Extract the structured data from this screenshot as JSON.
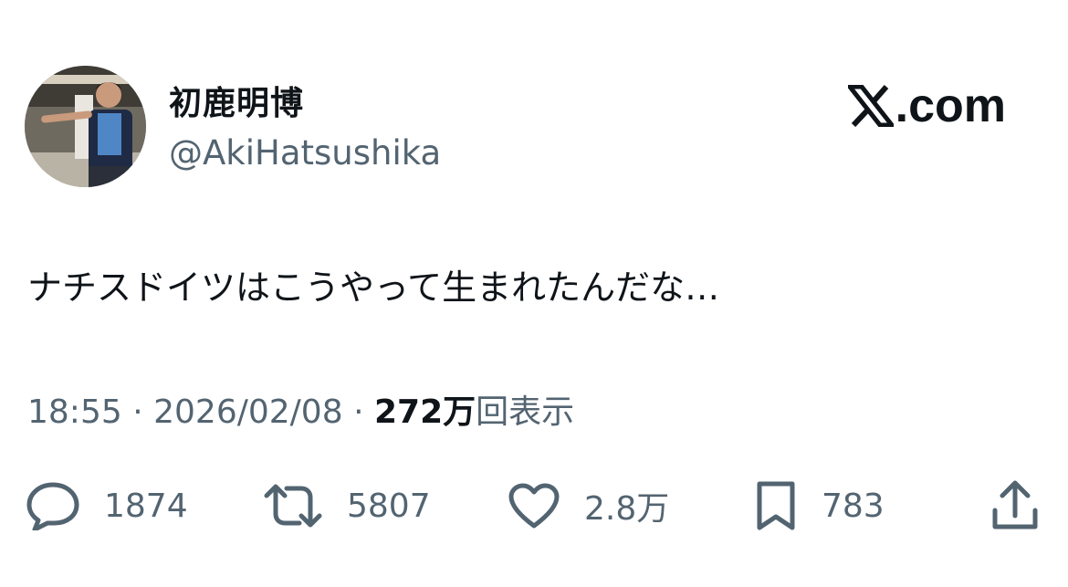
{
  "author": {
    "display_name": "初鹿明博",
    "handle": "@AkiHatsushika",
    "avatar_icon": "profile-photo"
  },
  "brand": {
    "label": ".com",
    "icon": "x-logo-icon"
  },
  "tweet": {
    "text": "ナチスドイツはこうやって生まれたんだな…",
    "time": "18:55",
    "date": "2026/02/08",
    "separator": "·",
    "views_count": "272万",
    "views_label": "回表示"
  },
  "actions": {
    "replies": {
      "icon": "reply-icon",
      "count": "1874"
    },
    "reposts": {
      "icon": "repost-icon",
      "count": "5807"
    },
    "likes": {
      "icon": "heart-icon",
      "count": "2.8万"
    },
    "bookmarks": {
      "icon": "bookmark-icon",
      "count": "783"
    },
    "share": {
      "icon": "share-icon"
    }
  },
  "colors": {
    "text_primary": "#0f1419",
    "text_secondary": "#536471",
    "background": "#ffffff"
  }
}
